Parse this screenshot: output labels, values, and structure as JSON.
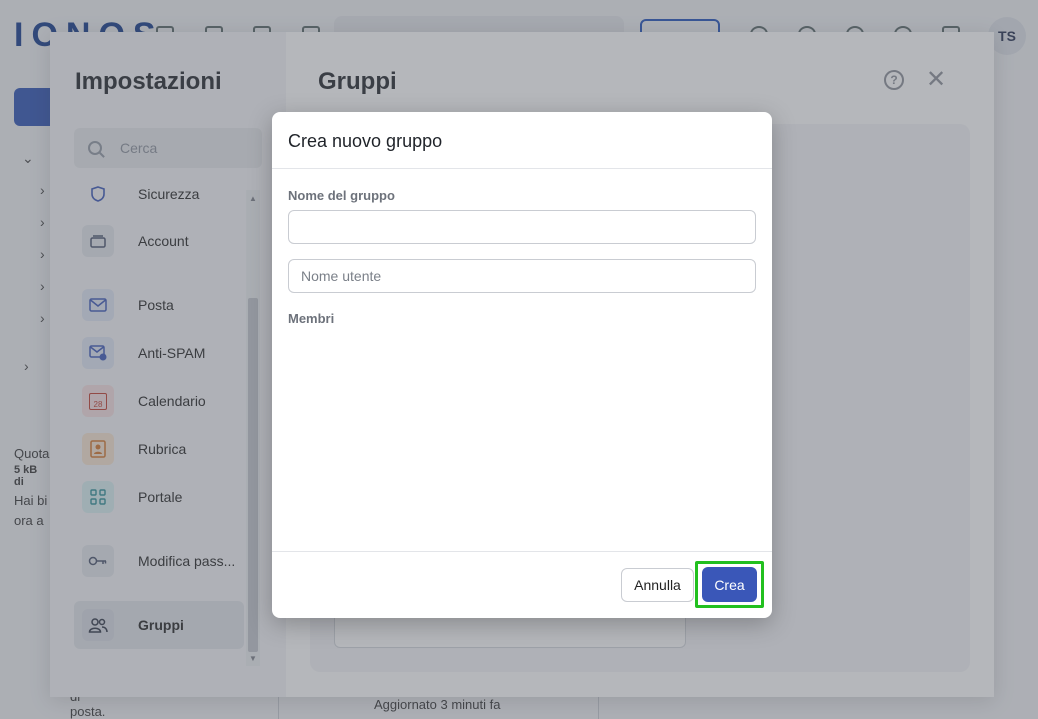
{
  "app": {
    "logo": "IONOS",
    "user_initials": "TS",
    "bottom_status": "Aggiornato 3 minuti fa"
  },
  "background": {
    "quota_label": "Quota",
    "quota_value": "5 kB di",
    "info_line1": "Hai bi",
    "info_line2": "ora a",
    "mail_hint": "di posta."
  },
  "settings": {
    "title": "Impostazioni",
    "search_placeholder": "Cerca",
    "nav": [
      {
        "label": "Sicurezza",
        "icon": "shield-icon"
      },
      {
        "label": "Account",
        "icon": "account-icon"
      },
      {
        "label": "Posta",
        "icon": "mail-icon"
      },
      {
        "label": "Anti-SPAM",
        "icon": "anti-spam-icon"
      },
      {
        "label": "Calendario",
        "icon": "calendar-icon",
        "icon_text": "28"
      },
      {
        "label": "Rubrica",
        "icon": "contacts-icon"
      },
      {
        "label": "Portale",
        "icon": "portal-icon"
      },
      {
        "label": "Modifica pass...",
        "icon": "key-icon"
      },
      {
        "label": "Gruppi",
        "icon": "groups-icon",
        "active": true
      }
    ],
    "main_title": "Gruppi",
    "help_glyph": "?",
    "close_glyph": "✕"
  },
  "modal": {
    "title": "Crea nuovo gruppo",
    "group_name_label": "Nome del gruppo",
    "group_name_value": "",
    "username_placeholder": "Nome utente",
    "members_label": "Membri",
    "cancel_label": "Annulla",
    "create_label": "Crea"
  },
  "colors": {
    "primary": "#3a57b8",
    "highlight": "#22c01f",
    "brand": "#11388a"
  }
}
